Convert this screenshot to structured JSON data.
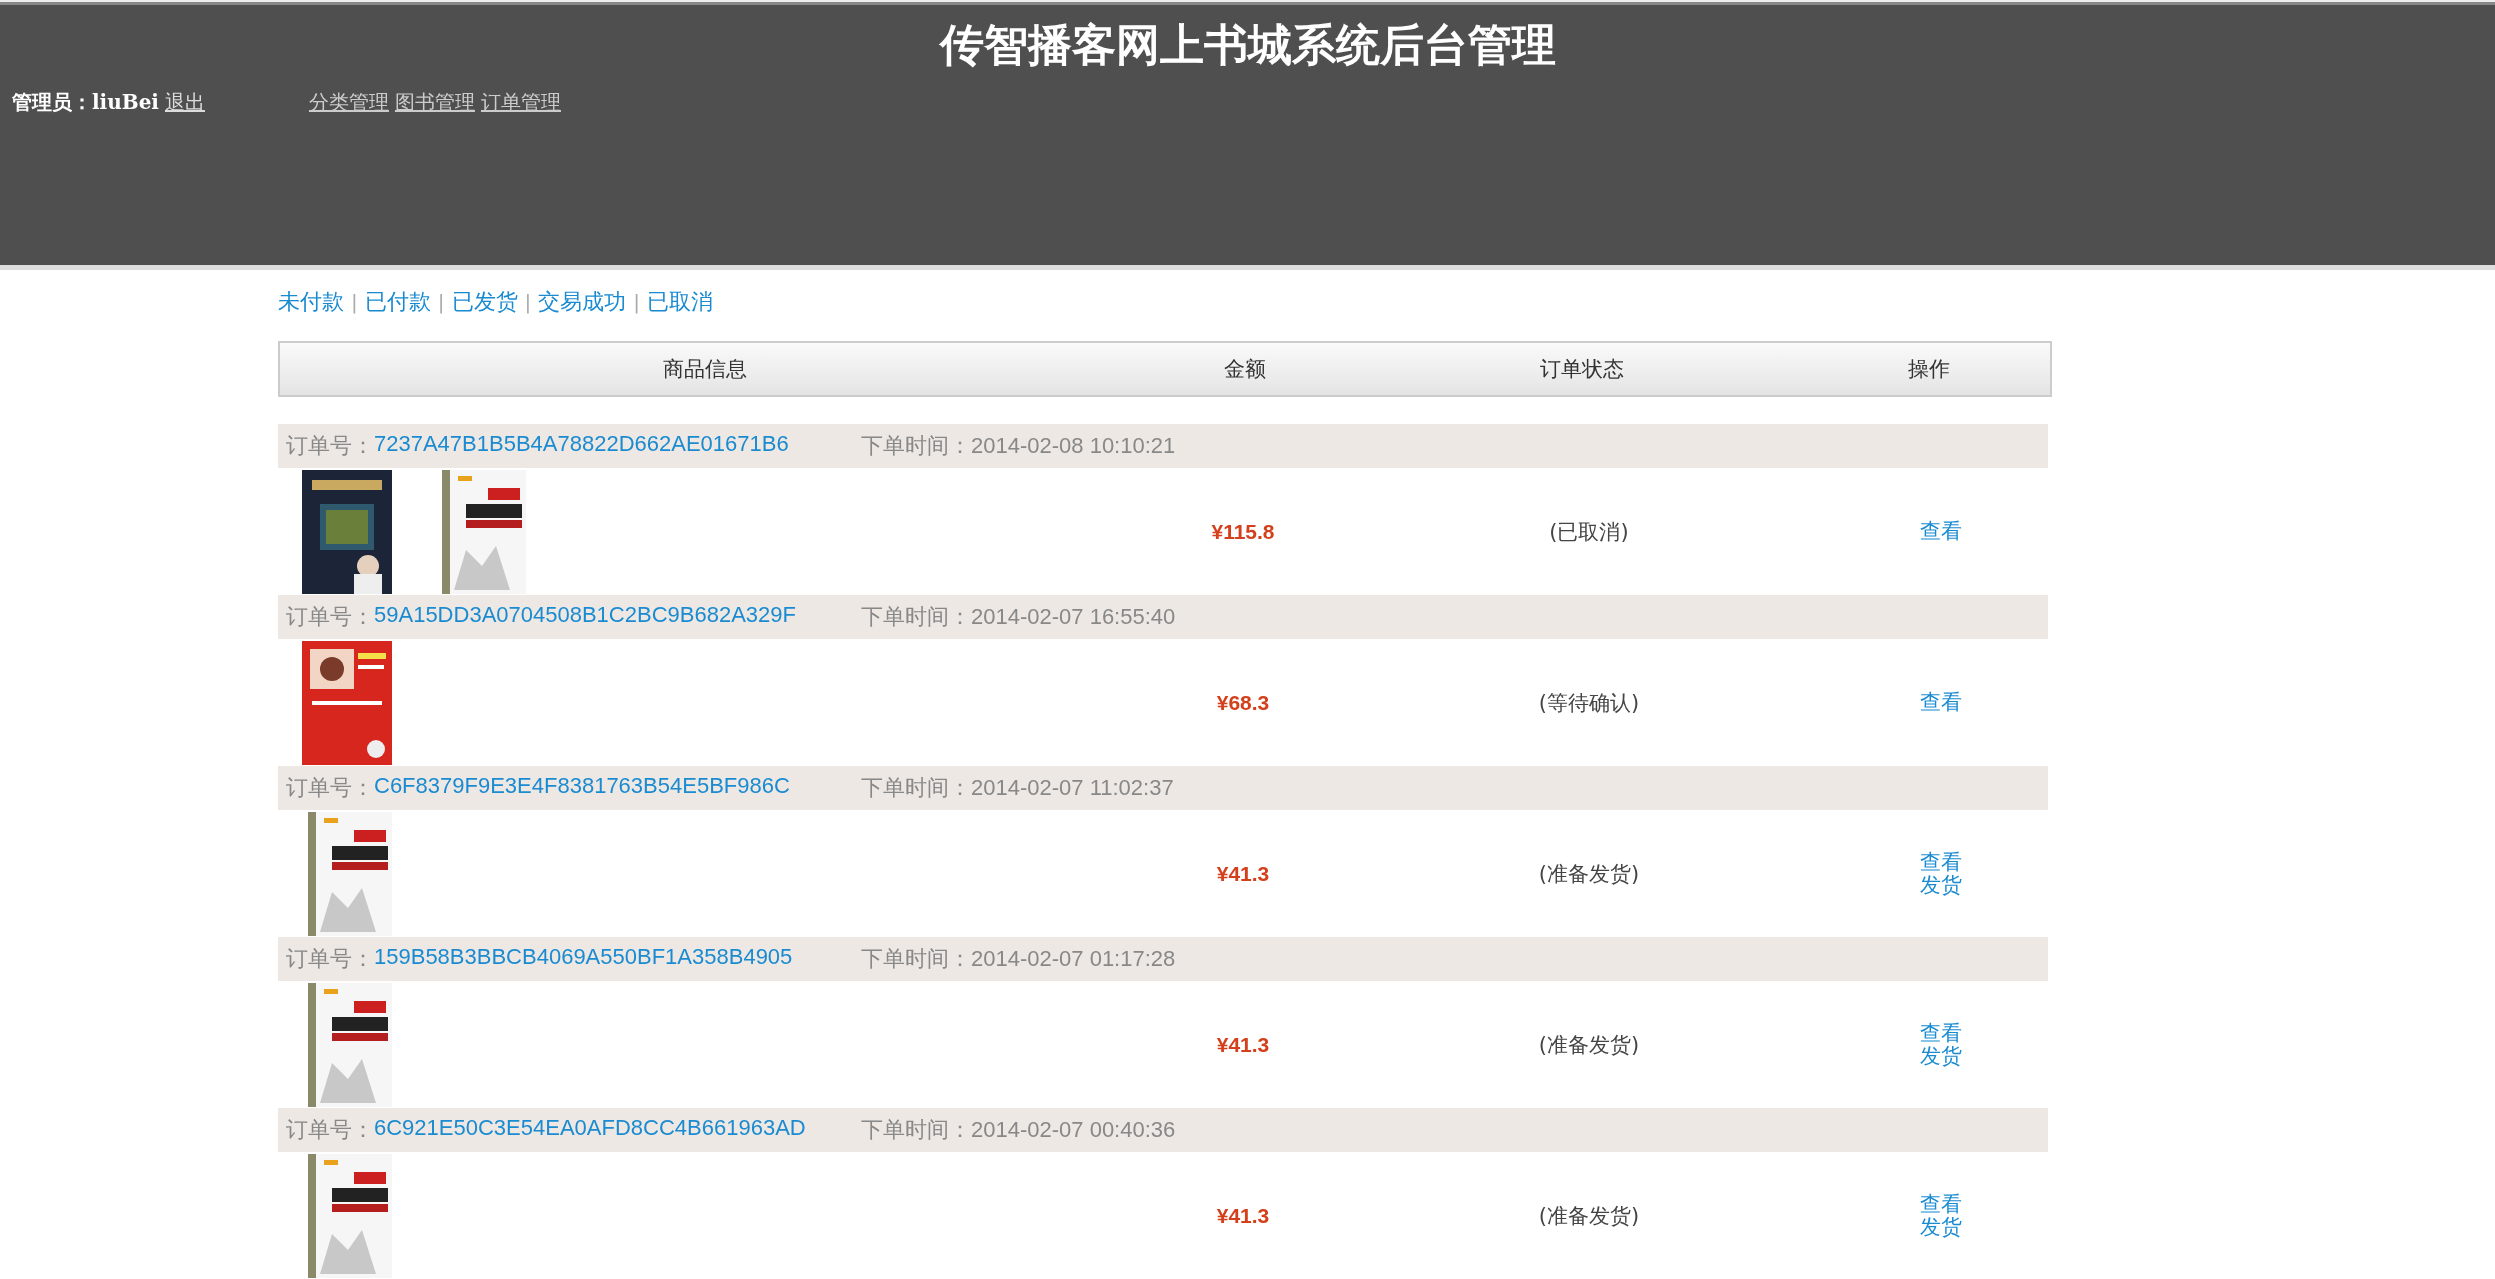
{
  "header": {
    "title": "传智播客网上书城系统后台管理",
    "admin_label": "管理员：",
    "admin_name": "liuBei",
    "logout": "退出",
    "nav": [
      "分类管理",
      "图书管理",
      "订单管理"
    ]
  },
  "status_filters": {
    "separator": "|",
    "items": [
      "未付款",
      "已付款",
      "已发货",
      "交易成功",
      "已取消"
    ]
  },
  "table": {
    "columns": [
      "商品信息",
      "金额",
      "订单状态",
      "操作"
    ]
  },
  "orders": [
    {
      "order_label": "订单号：",
      "order_no": "7237A47B1B5B4A78822D662AE01671B6",
      "time_label": "下单时间：",
      "time": "2014-02-08 10:10:21",
      "books": [
        {
          "kind": "picture"
        },
        {
          "kind": "picture"
        }
      ],
      "amount": "¥115.8",
      "status": "(已取消)",
      "actions": [
        "查看"
      ]
    },
    {
      "order_label": "订单号：",
      "order_no": "59A15DD3A0704508B1C2BC9B682A329F",
      "time_label": "下单时间：",
      "time": "2014-02-07 16:55:40",
      "books": [
        {
          "kind": "picture"
        }
      ],
      "amount": "¥68.3",
      "status": "(等待确认)",
      "actions": [
        "查看"
      ]
    },
    {
      "order_label": "订单号：",
      "order_no": "C6F8379F9E3E4F8381763B54E5BF986C",
      "time_label": "下单时间：",
      "time": "2014-02-07 11:02:37",
      "books": [
        {
          "kind": "picture"
        }
      ],
      "amount": "¥41.3",
      "status": "(准备发货)",
      "actions": [
        "查看",
        "发货"
      ]
    },
    {
      "order_label": "订单号：",
      "order_no": "159B58B3BBCB4069A550BF1A358B4905",
      "time_label": "下单时间：",
      "time": "2014-02-07 01:17:28",
      "books": [
        {
          "kind": "picture"
        }
      ],
      "amount": "¥41.3",
      "status": "(准备发货)",
      "actions": [
        "查看",
        "发货"
      ]
    },
    {
      "order_label": "订单号：",
      "order_no": "6C921E50C3E54EA0AFD8CC4B661963AD",
      "time_label": "下单时间：",
      "time": "2014-02-07 00:40:36",
      "books": [
        {
          "kind": "picture"
        }
      ],
      "amount": "¥41.3",
      "status": "(准备发货)",
      "actions": [
        "查看",
        "发货"
      ]
    }
  ]
}
